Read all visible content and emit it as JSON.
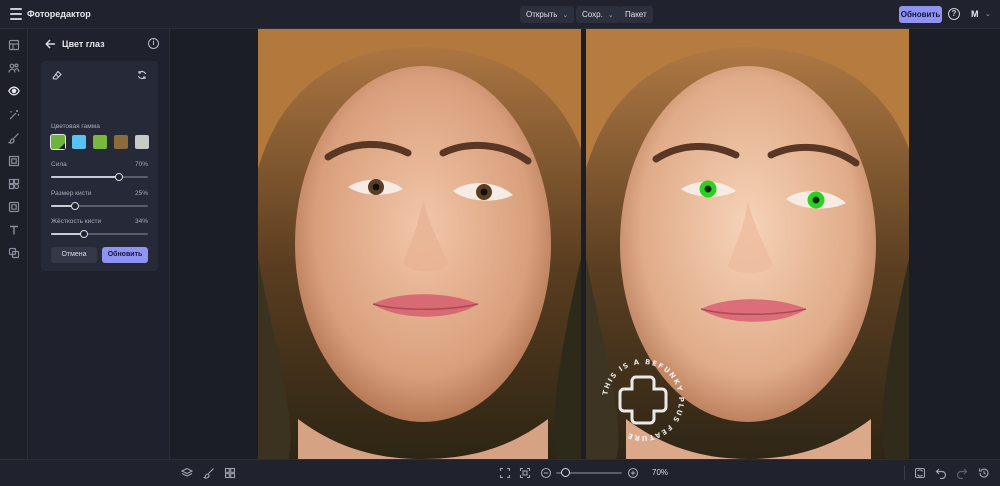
{
  "topbar": {
    "app_title": "Фоторедактор",
    "menus": [
      {
        "label": "Открыть",
        "has_dropdown": true
      },
      {
        "label": "Сохр.",
        "has_dropdown": true
      },
      {
        "label": "Пакет",
        "has_dropdown": false
      }
    ],
    "upgrade_label": "Обновить",
    "help_glyph": "?",
    "user_initial": "M"
  },
  "rail": {
    "icons": [
      "crop-icon",
      "portrait-touchup-icon",
      "eye-icon",
      "magic-wand-icon",
      "brush-icon",
      "frame-icon",
      "graphics-icon",
      "layers-icon",
      "text-icon",
      "texture-icon"
    ],
    "active": "eye-icon"
  },
  "panel": {
    "title": "Цвет глаз",
    "palette_label": "Цветовая гамма",
    "swatches": [
      {
        "color": "#6fb43a",
        "name": "custom-color",
        "selected": true
      },
      {
        "color": "#59c2f4",
        "name": "blue"
      },
      {
        "color": "#77b83d",
        "name": "green"
      },
      {
        "color": "#8b6a3c",
        "name": "brown"
      },
      {
        "color": "#c8cac8",
        "name": "gray"
      }
    ],
    "sliders": [
      {
        "label": "Сила",
        "value": 70,
        "value_text": "70%"
      },
      {
        "label": "Размер кисти",
        "value": 25,
        "value_text": "25%"
      },
      {
        "label": "Жёсткость кисти",
        "value": 34,
        "value_text": "34%"
      }
    ],
    "cancel_label": "Отмена",
    "apply_label": "Обновить"
  },
  "canvas": {
    "watermark_text": "THIS IS A BEFUNKY PLUS FEATURE",
    "eye_color_before": "#5b3d22",
    "eye_color_after": "#2ad21f"
  },
  "bottombar": {
    "zoom_value": 70,
    "zoom_text": "70%"
  },
  "colors": {
    "accent": "#8f93f4",
    "background": "#1b1d27",
    "panel": "#1f212c"
  }
}
